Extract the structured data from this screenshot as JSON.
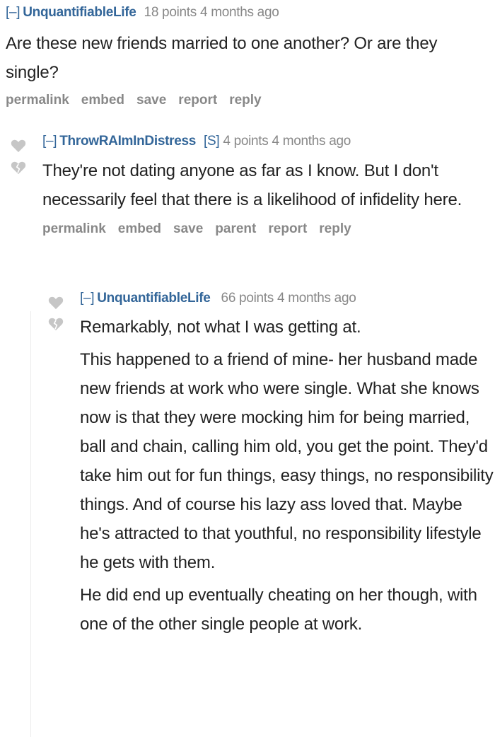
{
  "comments": [
    {
      "toggle": "[–]",
      "author": "UnquantifiableLife",
      "flair": "",
      "points": "18 points",
      "time": "4 months ago",
      "paragraphs": [
        "Are these new friends married to one another? Or are they single?"
      ],
      "buttons": [
        "permalink",
        "embed",
        "save",
        "report",
        "reply"
      ]
    },
    {
      "toggle": "[–]",
      "author": "ThrowRAImInDistress",
      "flair": "[S]",
      "points": "4 points",
      "time": "4 months ago",
      "paragraphs": [
        "They're not dating anyone as far as I know. But I don't necessarily feel that there is a likelihood of infidelity here."
      ],
      "buttons": [
        "permalink",
        "embed",
        "save",
        "parent",
        "report",
        "reply"
      ]
    },
    {
      "toggle": "[–]",
      "author": "UnquantifiableLife",
      "flair": "",
      "points": "66 points",
      "time": "4 months ago",
      "paragraphs": [
        "Remarkably, not what I was getting at.",
        "This happened to a friend of mine- her husband made new friends at work who were single. What she knows now is that they were mocking him for being married, ball and chain, calling him old, you get the point. They'd take him out for fun things, easy things, no responsibility things. And of course his lazy ass loved that. Maybe he's attracted to that youthful, no responsibility lifestyle he gets with them.",
        "He did end up eventually cheating on her though, with one of the other single people at work."
      ]
    }
  ],
  "colors": {
    "author": "#336699",
    "meta": "#888888",
    "text": "#222222",
    "arrow": "#c6c6c6"
  },
  "icons": {
    "upvote": "heart-upvote-icon",
    "downvote": "broken-heart-downvote-icon"
  }
}
